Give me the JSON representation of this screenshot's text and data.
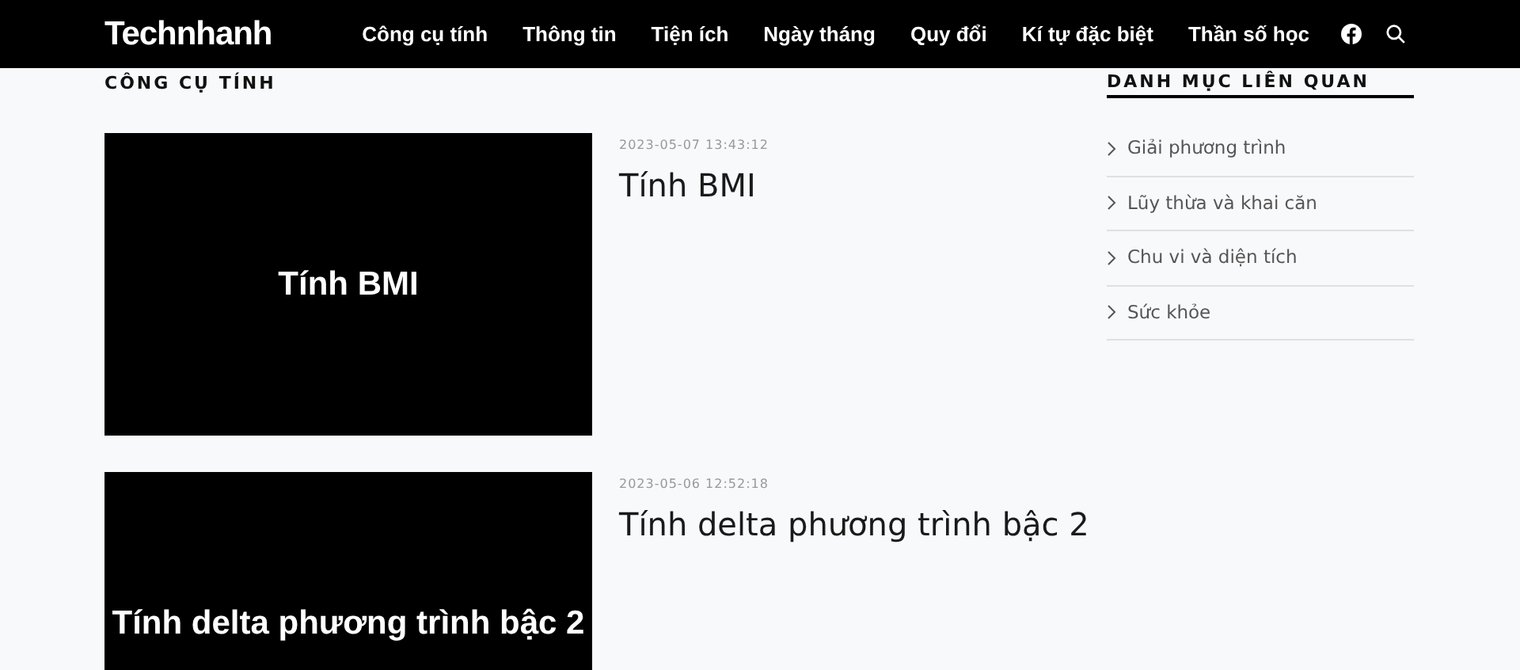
{
  "header": {
    "logo": "Technhanh",
    "nav": [
      {
        "label": "Công cụ tính"
      },
      {
        "label": "Thông tin"
      },
      {
        "label": "Tiện ích"
      },
      {
        "label": "Ngày tháng"
      },
      {
        "label": "Quy đổi"
      },
      {
        "label": "Kí tự đặc biệt"
      },
      {
        "label": "Thần số học"
      }
    ]
  },
  "section_title": "CÔNG CỤ TÍNH",
  "posts": [
    {
      "thumbnail_text": "Tính BMI",
      "date": "2023-05-07 13:43:12",
      "title": "Tính BMI"
    },
    {
      "thumbnail_text": "Tính delta phương trình bậc 2",
      "date": "2023-05-06 12:52:18",
      "title": "Tính delta phương trình bậc 2"
    }
  ],
  "sidebar": {
    "title": "DANH MỤC LIÊN QUAN",
    "items": [
      {
        "label": "Giải phương trình"
      },
      {
        "label": "Lũy thừa và khai căn"
      },
      {
        "label": "Chu vi và diện tích"
      },
      {
        "label": "Sức khỏe"
      }
    ]
  }
}
